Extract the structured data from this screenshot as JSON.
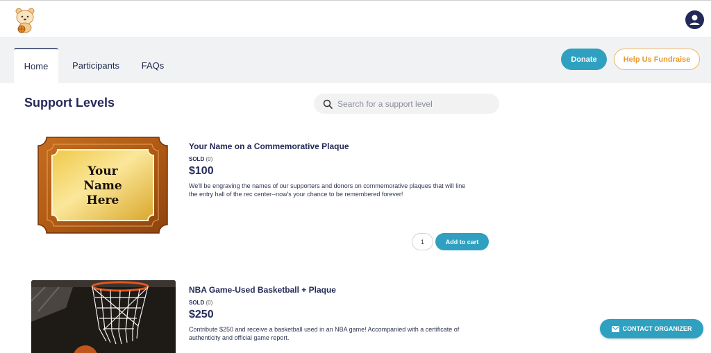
{
  "header": {
    "logo_icon": "bear-mascot-logo",
    "account_icon": "account-circle-icon"
  },
  "nav": {
    "tabs": [
      {
        "label": "Home",
        "active": true
      },
      {
        "label": "Participants",
        "active": false
      },
      {
        "label": "FAQs",
        "active": false
      }
    ],
    "donate_label": "Donate",
    "fundraise_label": "Help Us Fundraise"
  },
  "main": {
    "title": "Support Levels",
    "search_placeholder": "Search for a support level"
  },
  "items": [
    {
      "title": "Your Name on a Commemorative Plaque",
      "sold_label": "SOLD",
      "sold_count": "(0)",
      "price": "$100",
      "description": "We'll be engraving the names of our supporters and donors on commemorative plaques that will line the entry hall of the rec center--now's your chance to be remembered forever!",
      "quantity": "1",
      "add_label": "Add to cart",
      "image_text": [
        "Your",
        "Name",
        "Here"
      ]
    },
    {
      "title": "NBA Game-Used Basketball + Plaque",
      "sold_label": "SOLD",
      "sold_count": "(0)",
      "price": "$250",
      "description": "Contribute $250 and receive a basketball used in an NBA game! Accompanied with a certificate of authenticity and official game report."
    }
  ],
  "contact_label": "CONTACT ORGANIZER",
  "colors": {
    "accent": "#2fa0bf",
    "navy": "#232a58",
    "orange": "#e69a2e"
  }
}
